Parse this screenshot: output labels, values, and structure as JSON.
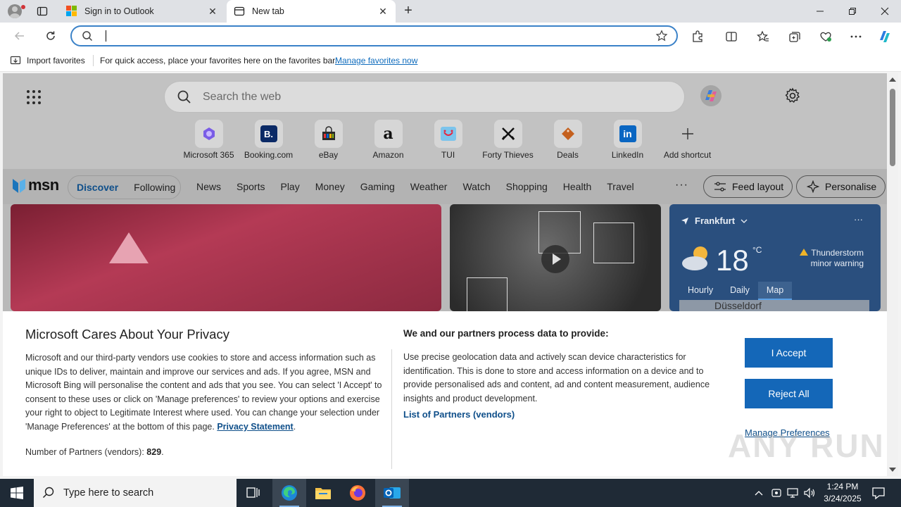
{
  "tabs": [
    {
      "title": "Sign in to Outlook"
    },
    {
      "title": "New tab"
    }
  ],
  "address_bar": {
    "value": "",
    "placeholder": ""
  },
  "favorites_bar": {
    "import_label": "Import favorites",
    "hint": "For quick access, place your favorites here on the favorites bar.",
    "manage_link": "Manage favorites now"
  },
  "newtab": {
    "search_placeholder": "Search the web",
    "shortcuts": [
      {
        "label": "Microsoft 365",
        "icon": "microsoft-365-icon",
        "color": "#6b4fd8"
      },
      {
        "label": "Booking.com",
        "icon": "booking-icon",
        "color": "#0b2a66"
      },
      {
        "label": "eBay",
        "icon": "ebay-icon",
        "color": "#1a1a1a"
      },
      {
        "label": "Amazon",
        "icon": "amazon-icon",
        "color": "#111111"
      },
      {
        "label": "TUI",
        "icon": "tui-icon",
        "color": "#63b7e6"
      },
      {
        "label": "Forty Thieves",
        "icon": "swords-icon",
        "color": "#1a1a1a"
      },
      {
        "label": "Deals",
        "icon": "tag-icon",
        "color": "#c4601e"
      },
      {
        "label": "LinkedIn",
        "icon": "linkedin-icon",
        "color": "#0a66c2"
      },
      {
        "label": "Add shortcut",
        "icon": "plus-icon",
        "color": "#333333"
      }
    ]
  },
  "msn": {
    "logo_text": "msn",
    "feed_tabs": [
      "Discover",
      "Following"
    ],
    "categories": [
      "News",
      "Sports",
      "Play",
      "Money",
      "Gaming",
      "Weather",
      "Watch",
      "Shopping",
      "Health",
      "Travel"
    ],
    "more": "···",
    "feed_layout": "Feed layout",
    "personalise": "Personalise"
  },
  "weather": {
    "location": "Frankfurt",
    "temp": "18",
    "unit": "°C",
    "warning": "Thunderstorm minor warning",
    "tabs": [
      "Hourly",
      "Daily",
      "Map"
    ],
    "selected_tab": "Map",
    "map_label": "Düsseldorf"
  },
  "privacy": {
    "title": "Microsoft Cares About Your Privacy",
    "body": "Microsoft and our third-party vendors use cookies to store and access information such as unique IDs to deliver, maintain and improve our services and ads. If you agree, MSN and Microsoft Bing will personalise the content and ads that you see. You can select 'I Accept' to consent to these uses or click on 'Manage preferences' to review your options and exercise your right to object to Legitimate Interest where used.  You can change your selection under 'Manage Preferences' at the bottom of this page.",
    "privacy_link": "Privacy Statement",
    "partners_label": "Number of Partners (vendors):",
    "partners_count": "829",
    "process_title": "We and our partners process data to provide:",
    "process_body": "Use precise geolocation data and actively scan device characteristics for identification. This is done to store and access information on a device and to provide personalised ads and content, ad and content measurement, audience insights and product development.",
    "list_link": "List of Partners (vendors)",
    "accept": "I Accept",
    "reject": "Reject All",
    "manage": "Manage Preferences"
  },
  "watermark": "ANY RUN",
  "taskbar": {
    "search_placeholder": "Type here to search",
    "time": "1:24 PM",
    "date": "3/24/2025"
  }
}
